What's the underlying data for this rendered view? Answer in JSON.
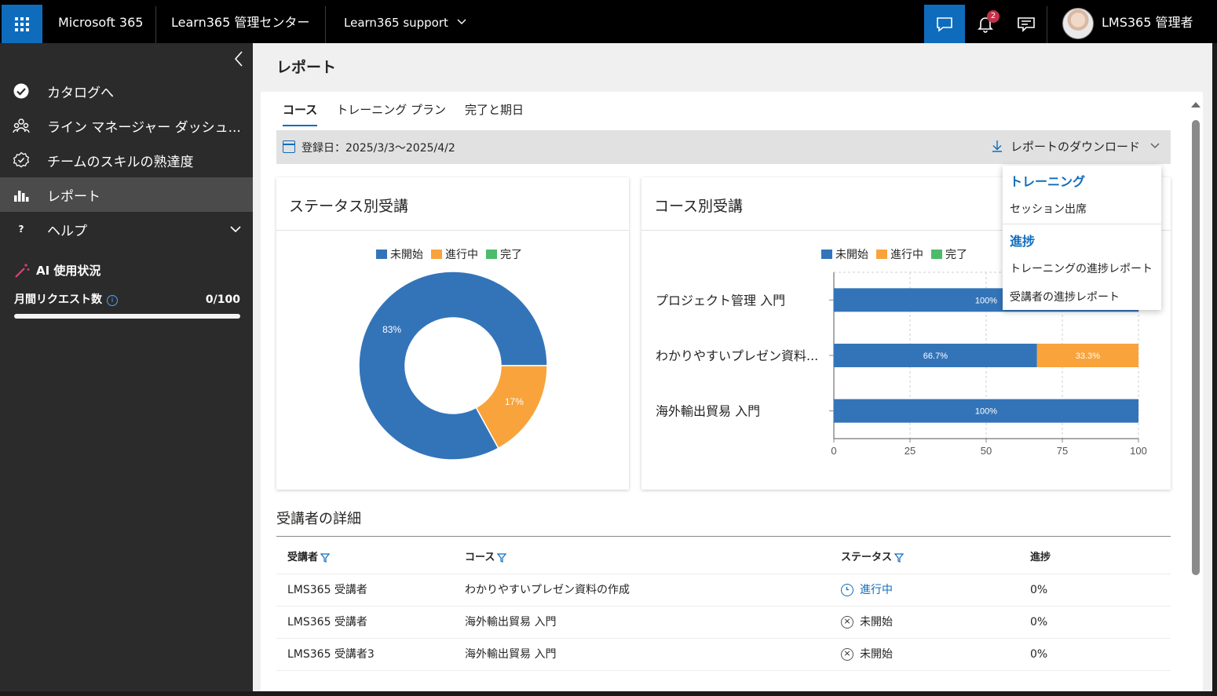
{
  "topbar": {
    "app_name": "Microsoft 365",
    "admin_center": "Learn365 管理センター",
    "tenant": "Learn365 support",
    "notification_count": "2",
    "user_name": "LMS365 管理者"
  },
  "sidebar": {
    "items": [
      {
        "label": "カタログへ",
        "icon": "checkmark-circle-icon"
      },
      {
        "label": "ライン マネージャー ダッシュ...",
        "icon": "people-icon"
      },
      {
        "label": "チームのスキルの熟達度",
        "icon": "badge-gear-icon"
      },
      {
        "label": "レポート",
        "icon": "bar-chart-icon"
      },
      {
        "label": "ヘルプ",
        "icon": "question-icon"
      }
    ],
    "ai": {
      "title": "AI 使用状況",
      "requests_label": "月間リクエスト数",
      "requests_value": "0/100",
      "usage_fraction": 0
    }
  },
  "page": {
    "title": "レポート",
    "tabs": [
      "コース",
      "トレーニング プラン",
      "完了と期日"
    ],
    "active_tab": "コース",
    "date_filter": "登録日：2025/3/3～2025/4/2",
    "download_label": "レポートのダウンロード"
  },
  "dropdown": {
    "section1_title": "トレーニング",
    "section1_items": [
      "セッション出席"
    ],
    "section2_title": "進捗",
    "section2_items": [
      "トレーニングの進捗レポート",
      "受講者の進捗レポート"
    ]
  },
  "colors": {
    "not_started": "#3374b9",
    "in_progress": "#f9a33c",
    "completed": "#4cbb6c",
    "accent": "#0f6cbd"
  },
  "legend": [
    "未開始",
    "進行中",
    "完了"
  ],
  "chart_data": [
    {
      "type": "pie",
      "title": "ステータス別受講",
      "labels": [
        "未開始",
        "進行中",
        "完了"
      ],
      "values": [
        83,
        17,
        0
      ],
      "value_labels": [
        "83%",
        "17%",
        ""
      ]
    },
    {
      "type": "bar",
      "orientation": "horizontal",
      "stacked": true,
      "title": "コース別受講",
      "categories": [
        "プロジェクト管理 入門",
        "わかりやすいプレゼン資料...",
        "海外輸出貿易 入門"
      ],
      "series": [
        {
          "name": "未開始",
          "values": [
            100,
            66.7,
            100
          ],
          "labels": [
            "100%",
            "66.7%",
            "100%"
          ]
        },
        {
          "name": "進行中",
          "values": [
            0,
            33.3,
            0
          ],
          "labels": [
            "",
            "33.3%",
            ""
          ]
        },
        {
          "name": "完了",
          "values": [
            0,
            0,
            0
          ],
          "labels": [
            "",
            "",
            ""
          ]
        }
      ],
      "xlim": [
        0,
        100
      ],
      "xticks": [
        "0",
        "25",
        "50",
        "75",
        "100"
      ],
      "grid": true
    }
  ],
  "details": {
    "title": "受講者の詳細",
    "columns": [
      "受講者",
      "コース",
      "ステータス",
      "進捗"
    ],
    "rows": [
      {
        "learner": "LMS365 受講者",
        "course": "わかりやすいプレゼン資料の作成",
        "status": "進行中",
        "status_icon": "clock-icon",
        "progress": "0%"
      },
      {
        "learner": "LMS365 受講者",
        "course": "海外輸出貿易 入門",
        "status": "未開始",
        "status_icon": "x-circle-icon",
        "progress": "0%"
      },
      {
        "learner": "LMS365 受講者3",
        "course": "海外輸出貿易 入門",
        "status": "未開始",
        "status_icon": "x-circle-icon",
        "progress": "0%"
      }
    ]
  }
}
